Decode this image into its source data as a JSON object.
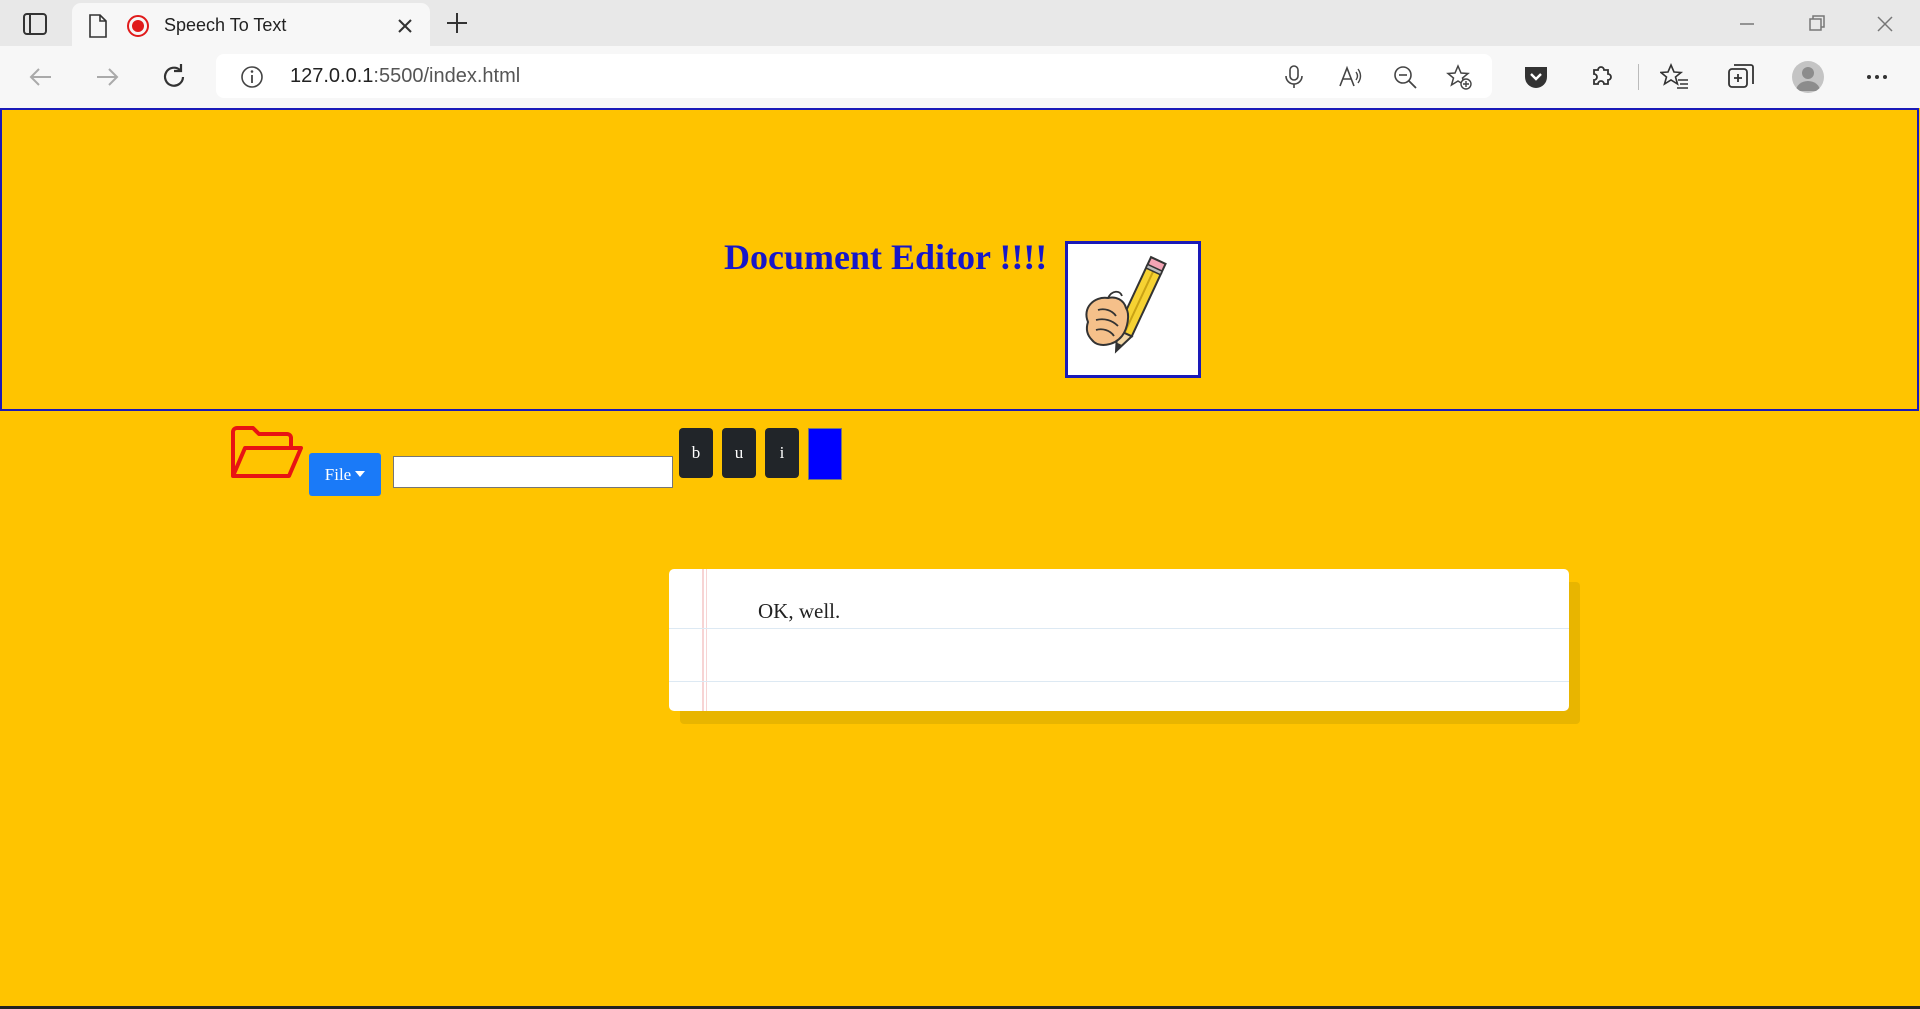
{
  "browser": {
    "tab_title": "Speech To Text",
    "url_host": "127.0.0.1",
    "url_rest": ":5500/index.html"
  },
  "header": {
    "title": "Document Editor !!!!"
  },
  "toolbar": {
    "file_label": "File",
    "filename_value": "",
    "bold_label": "b",
    "underline_label": "u",
    "italic_label": "i",
    "text_color": "#0000ff"
  },
  "editor": {
    "text": "OK, well."
  },
  "colors": {
    "page_background": "#ffc400",
    "heading": "#1717c8",
    "file_button": "#1a7af8",
    "format_buttons": "#212529"
  }
}
